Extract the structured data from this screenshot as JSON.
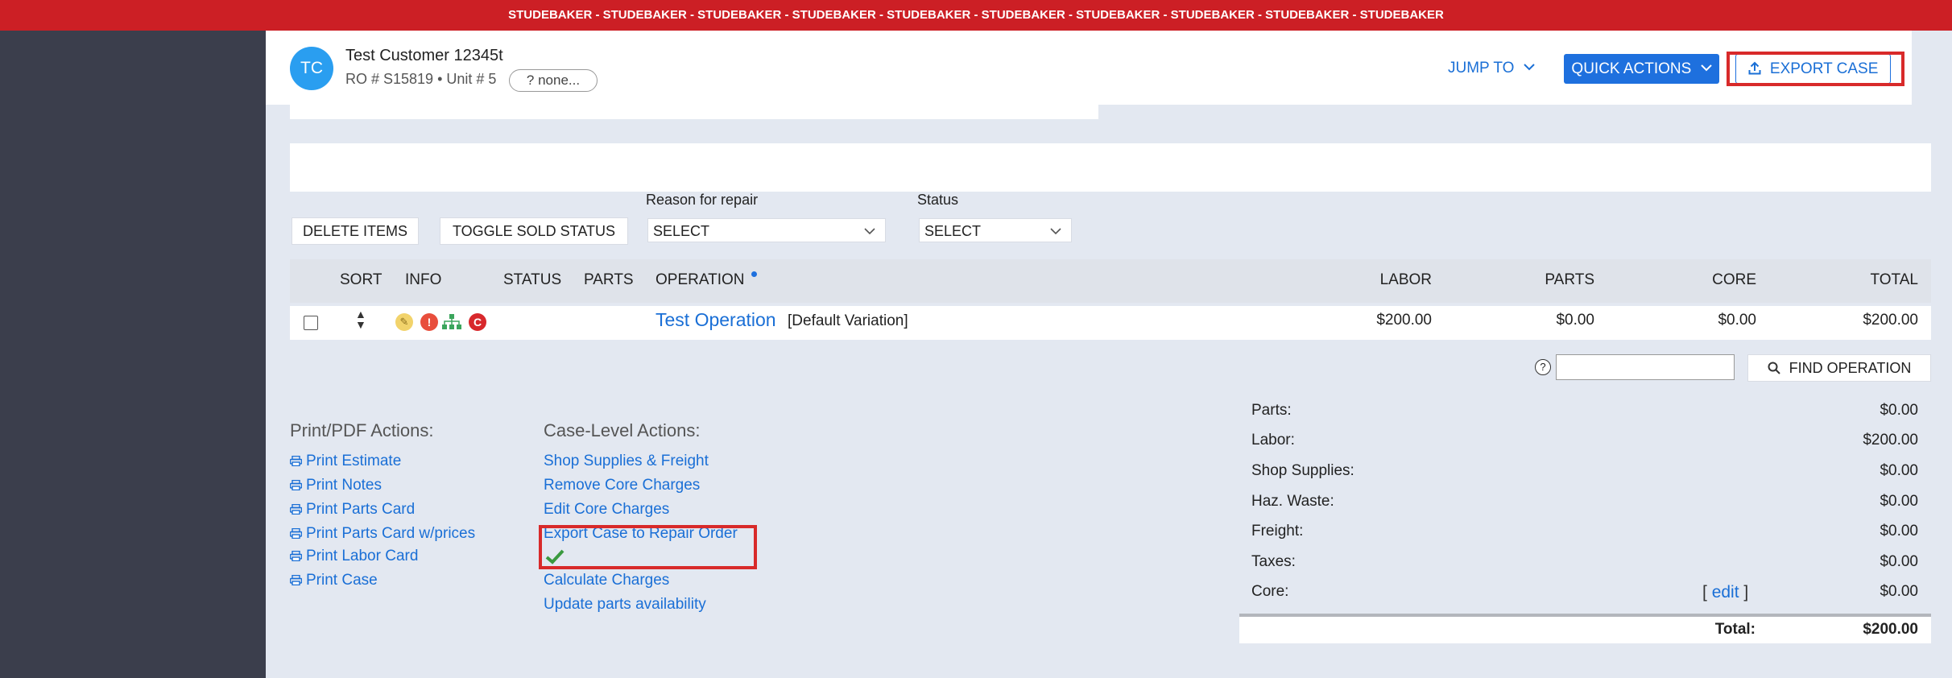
{
  "banner": {
    "text": "STUDEBAKER - STUDEBAKER - STUDEBAKER - STUDEBAKER - STUDEBAKER - STUDEBAKER - STUDEBAKER - STUDEBAKER - STUDEBAKER - STUDEBAKER"
  },
  "header": {
    "avatar_initials": "TC",
    "customer_name": "Test Customer 12345t",
    "ro_line": "RO # S15819 • Unit # 5",
    "tag_pill": "?  none...",
    "jump_to": "JUMP TO",
    "quick_actions": "QUICK ACTIONS",
    "export_case": "EXPORT CASE"
  },
  "toolbar": {
    "delete_items": "DELETE ITEMS",
    "toggle_sold_status": "TOGGLE SOLD STATUS",
    "reason_label": "Reason for repair",
    "reason_value": "SELECT",
    "status_label": "Status",
    "status_value": "SELECT"
  },
  "table": {
    "headers": {
      "sort": "SORT",
      "info": "INFO",
      "status": "STATUS",
      "parts_col": "PARTS",
      "operation": "OPERATION",
      "labor": "LABOR",
      "parts": "PARTS",
      "core": "CORE",
      "total": "TOTAL"
    },
    "rows": [
      {
        "operation": "Test Operation",
        "variation": "[Default Variation]",
        "labor": "$200.00",
        "parts": "$0.00",
        "core": "$0.00",
        "total": "$200.00"
      }
    ]
  },
  "find": {
    "help": "?",
    "button": "FIND OPERATION"
  },
  "print_actions": {
    "title": "Print/PDF Actions:",
    "items": [
      "Print Estimate",
      "Print Notes",
      "Print Parts Card",
      "Print Parts Card w/prices",
      "Print Labor Card",
      "Print Case"
    ]
  },
  "case_actions": {
    "title": "Case-Level Actions:",
    "items": [
      "Shop Supplies & Freight",
      "Remove Core Charges",
      "Edit Core Charges",
      "Export Case to Repair Order",
      "Calculate Charges",
      "Update parts availability"
    ]
  },
  "summary": {
    "rows": [
      {
        "label": "Parts:",
        "value": "$0.00"
      },
      {
        "label": "Labor:",
        "value": "$200.00"
      },
      {
        "label": "Shop Supplies:",
        "value": "$0.00"
      },
      {
        "label": "Haz. Waste:",
        "value": "$0.00"
      },
      {
        "label": "Freight:",
        "value": "$0.00"
      },
      {
        "label": "Taxes:",
        "value": "$0.00"
      },
      {
        "label": "Core:",
        "value": "$0.00"
      }
    ],
    "core_edit_open": "[",
    "core_edit": "edit",
    "core_edit_close": "]",
    "total_label": "Total:",
    "total_value": "$200.00"
  },
  "colors": {
    "banner": "#cc1f25",
    "sidebar": "#3b3e4c",
    "accent": "#1e70de",
    "highlight": "#d82a2a"
  }
}
